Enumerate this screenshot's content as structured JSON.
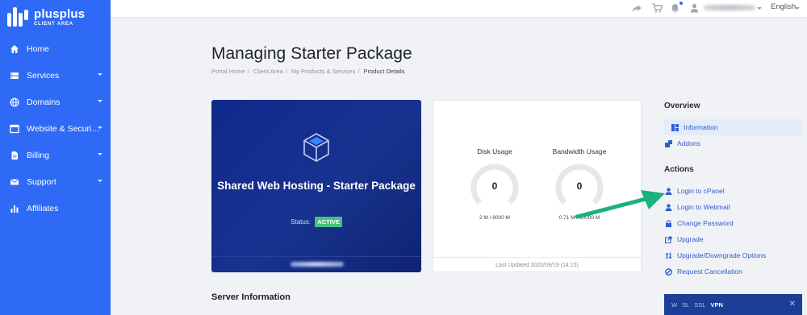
{
  "brand": {
    "title": "plusplus",
    "subtitle": "CLIENT AREA"
  },
  "sidebar": {
    "items": [
      {
        "label": "Home",
        "icon": "home-icon",
        "has_caret": false
      },
      {
        "label": "Services",
        "icon": "server-icon",
        "has_caret": true
      },
      {
        "label": "Domains",
        "icon": "globe-icon",
        "has_caret": true
      },
      {
        "label": "Website & Securi…",
        "icon": "browser-icon",
        "has_caret": true
      },
      {
        "label": "Billing",
        "icon": "file-icon",
        "has_caret": true
      },
      {
        "label": "Support",
        "icon": "envelope-icon",
        "has_caret": true
      },
      {
        "label": "Affiliates",
        "icon": "bar-chart-icon",
        "has_caret": false
      }
    ]
  },
  "topbar": {
    "language": "English"
  },
  "page": {
    "title": "Managing Starter Package"
  },
  "breadcrumb": [
    "Portal Home",
    "Client Area",
    "My Products & Services",
    "Product Details"
  ],
  "product": {
    "name": "Shared Web Hosting - Starter Package",
    "status_label": "Status:",
    "status_value": "ACTIVE"
  },
  "usage": {
    "disk": {
      "label": "Disk Usage",
      "value": "0",
      "detail": "2 M / 8000 M",
      "fraction": 0.0
    },
    "bandwidth": {
      "label": "Bandwidth Usage",
      "value": "0",
      "detail": "0.71 M / 80000 M",
      "fraction": 0.0
    },
    "last_updated": "Last Updated 2020/09/19 (14:15)"
  },
  "server_info": {
    "title": "Server Information"
  },
  "right": {
    "overview_title": "Overview",
    "overview_items": [
      {
        "label": "Information",
        "icon": "grid-icon",
        "active": true
      },
      {
        "label": "Addons",
        "icon": "puzzle-icon",
        "active": false
      }
    ],
    "actions_title": "Actions",
    "action_items": [
      {
        "label": "Login to cPanel",
        "icon": "user-icon"
      },
      {
        "label": "Login to Webmail",
        "icon": "user-icon"
      },
      {
        "label": "Change Password",
        "icon": "lock-icon"
      },
      {
        "label": "Upgrade",
        "icon": "external-icon"
      },
      {
        "label": "Upgrade/Downgrade Options",
        "icon": "arrows-icon"
      },
      {
        "label": "Request Cancellation",
        "icon": "ban-icon"
      }
    ]
  },
  "promo": {
    "tabs": [
      "W",
      "SL",
      "SSL",
      "VPN"
    ],
    "selected": "VPN"
  },
  "colors": {
    "sidebar": "#2f6af6",
    "card": "#17328f",
    "badge": "#45c27d",
    "link": "#2f5bd3",
    "arrow": "#19b27a"
  }
}
